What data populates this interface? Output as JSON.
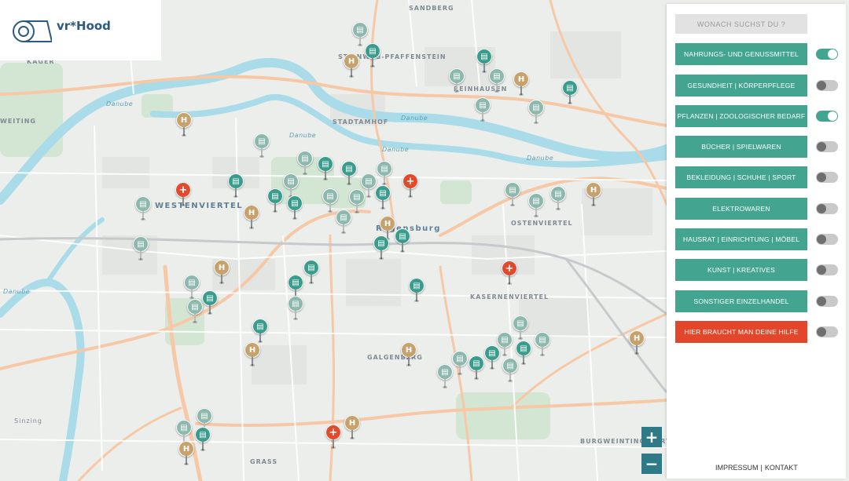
{
  "app": {
    "title": "vr*Hood"
  },
  "map": {
    "labels": [
      {
        "text": "SANDBERG",
        "kind": "district"
      },
      {
        "text": "STADTAMHOF",
        "kind": "district"
      },
      {
        "text": "STEINWEG-PFAFFENSTEIN",
        "kind": "district"
      },
      {
        "text": "REINHAUSEN",
        "kind": "district"
      },
      {
        "text": "WESTENVIERTEL",
        "kind": "city"
      },
      {
        "text": "Regensburg",
        "kind": "city"
      },
      {
        "text": "OSTENVIERTEL",
        "kind": "district"
      },
      {
        "text": "KASERNENVIERTEL",
        "kind": "district"
      },
      {
        "text": "GALGENBERG",
        "kind": "district"
      },
      {
        "text": "BURGWEINTING-HARTING",
        "kind": "district"
      },
      {
        "text": "GRASS",
        "kind": "district"
      },
      {
        "text": "KAGER",
        "kind": "district"
      },
      {
        "text": "WEITING",
        "kind": "district"
      },
      {
        "text": "Sinzing",
        "kind": "district"
      },
      {
        "text": "Danube",
        "kind": "water"
      },
      {
        "text": "Danube",
        "kind": "water"
      },
      {
        "text": "Danube",
        "kind": "water"
      },
      {
        "text": "Danube",
        "kind": "water"
      },
      {
        "text": "Danube",
        "kind": "water"
      },
      {
        "text": "Danube",
        "kind": "water"
      }
    ],
    "pin_icons": {
      "teal": "shop-icon",
      "faded": "shop-icon",
      "gold": "house-icon",
      "red": "plus-icon"
    }
  },
  "panel": {
    "search_placeholder": "WONACH SUCHST DU ?",
    "categories": [
      {
        "label": "NAHRUNGS- UND GENUSSMITTEL",
        "enabled": true
      },
      {
        "label": "GESUNDHEIT | KÖRPERPFLEGE",
        "enabled": false
      },
      {
        "label": "PFLANZEN | ZOOLOGISCHER BEDARF",
        "enabled": true
      },
      {
        "label": "BÜCHER | SPIELWAREN",
        "enabled": false
      },
      {
        "label": "BEKLEIDUNG | SCHUHE | SPORT",
        "enabled": false
      },
      {
        "label": "ELEKTROWAREN",
        "enabled": false
      },
      {
        "label": "HAUSRAT | EINRICHTUNG | MÖBEL",
        "enabled": false
      },
      {
        "label": "KUNST | KREATIVES",
        "enabled": false
      },
      {
        "label": "SONSTIGER EINZELHANDEL",
        "enabled": false
      },
      {
        "label": "HIER BRAUCHT MAN DEINE HILFE",
        "enabled": false
      }
    ],
    "footer": {
      "impressum": "IMPRESSUM",
      "separator": "|",
      "kontakt": "KONTAKT"
    }
  },
  "zoom": {
    "in": "+",
    "out": "−"
  },
  "colors": {
    "accent": "#43a58f",
    "help": "#e2472b",
    "teal_pin": "#3a9c8c",
    "gold_pin": "#c8a26c",
    "red_pin": "#e24a2e",
    "zoom_button": "#2f7a88",
    "river": "#a9dbe8",
    "road": "#f6c8a6"
  }
}
